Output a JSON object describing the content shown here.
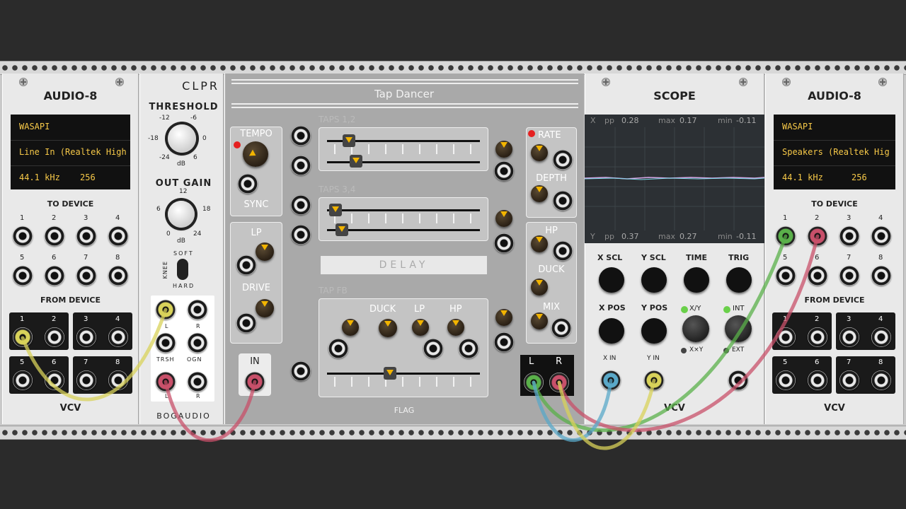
{
  "audio_left": {
    "title": "AUDIO-8",
    "driver": "WASAPI",
    "device": "Line In (Realtek High",
    "sample_rate": "44.1 kHz",
    "block_size": "256",
    "to_device": "TO DEVICE",
    "from_device": "FROM DEVICE",
    "logo": "VCV",
    "ch": [
      "1",
      "2",
      "3",
      "4",
      "5",
      "6",
      "7",
      "8"
    ]
  },
  "clpr": {
    "title": "CLPR",
    "threshold": "THRESHOLD",
    "th_ticks": [
      "-12",
      "-6",
      "-18",
      "0",
      "-24",
      "6"
    ],
    "db": "dB",
    "out_gain": "OUT GAIN",
    "og_ticks": [
      "12",
      "6",
      "18",
      "0",
      "24"
    ],
    "soft": "SOFT",
    "knee": "KNEE",
    "hard": "HARD",
    "l": "L",
    "r": "R",
    "trsh": "TRSH",
    "ogn": "OGN",
    "brand": "BOGAUDIO"
  },
  "tap": {
    "title": "Tap Dancer",
    "tempo": "TEMPO",
    "sync": "SYNC",
    "taps12": "TAPS 1,2",
    "taps34": "TAPS 3,4",
    "lp": "LP",
    "drive": "DRIVE",
    "delay": "DELAY",
    "tapfb": "TAP FB",
    "duck": "DUCK",
    "hp": "HP",
    "in": "IN",
    "rate": "RATE",
    "depth": "DEPTH",
    "mix": "MIX",
    "l": "L",
    "r": "R",
    "flag": "FLAG"
  },
  "scope": {
    "title": "SCOPE",
    "x": "X",
    "pp": "pp",
    "xpp": "0.28",
    "max": "max",
    "xmax": "0.17",
    "min": "min",
    "xmin": "-0.11",
    "y": "Y",
    "ypp": "0.37",
    "ymax": "0.27",
    "ymin": "-0.11",
    "xscl": "X SCL",
    "yscl": "Y SCL",
    "time": "TIME",
    "trig": "TRIG",
    "xpos": "X POS",
    "ypos": "Y POS",
    "xy": "X/Y",
    "xxy": "X×Y",
    "int": "INT",
    "ext": "EXT",
    "xin": "X IN",
    "yin": "Y IN",
    "logo": "VCV"
  },
  "audio_right": {
    "title": "AUDIO-8",
    "driver": "WASAPI",
    "device": "Speakers (Realtek Hig",
    "sample_rate": "44.1 kHz",
    "block_size": "256",
    "to_device": "TO DEVICE",
    "from_device": "FROM DEVICE",
    "logo": "VCV",
    "ch": [
      "1",
      "2",
      "3",
      "4",
      "5",
      "6",
      "7",
      "8"
    ]
  },
  "colors": {
    "cable_yellow": "#d8d25a",
    "cable_red": "#c8506a",
    "cable_green": "#5ab04a",
    "cable_blue": "#5aa8c8"
  }
}
